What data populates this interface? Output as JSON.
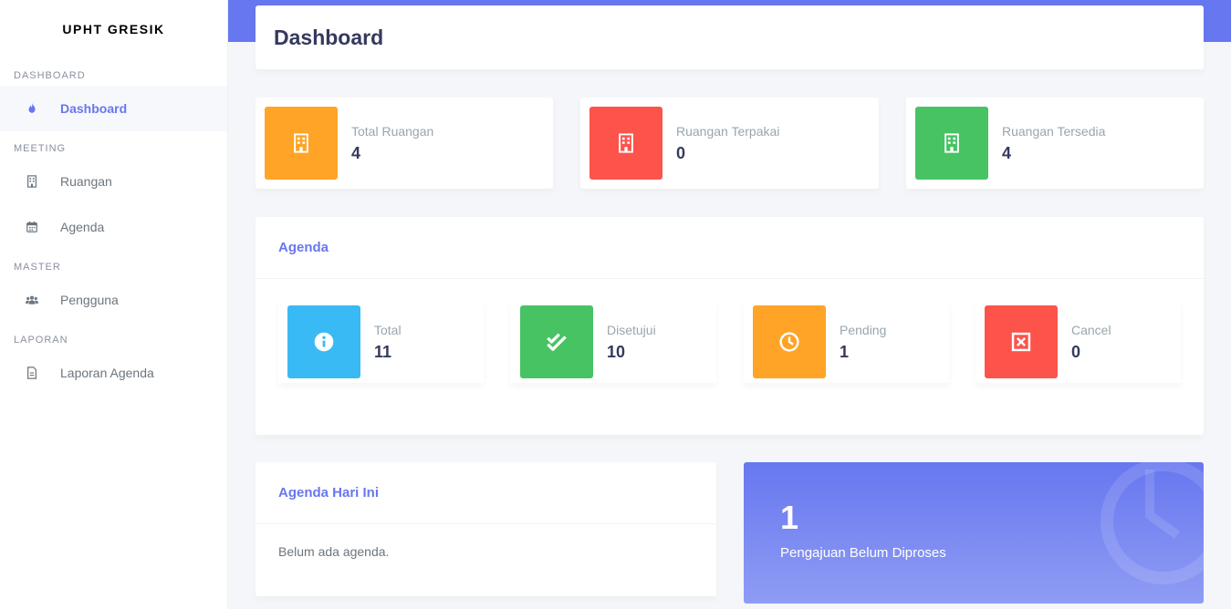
{
  "brand": "UPHT GRESIK",
  "sidebar": {
    "sections": [
      {
        "header": "DASHBOARD",
        "items": [
          {
            "label": "Dashboard",
            "icon": "fire-icon",
            "active": true
          }
        ]
      },
      {
        "header": "MEETING",
        "items": [
          {
            "label": "Ruangan",
            "icon": "building-icon"
          },
          {
            "label": "Agenda",
            "icon": "calendar-icon"
          }
        ]
      },
      {
        "header": "MASTER",
        "items": [
          {
            "label": "Pengguna",
            "icon": "users-icon"
          }
        ]
      },
      {
        "header": "LAPORAN",
        "items": [
          {
            "label": "Laporan Agenda",
            "icon": "file-icon"
          }
        ]
      }
    ]
  },
  "page": {
    "title": "Dashboard"
  },
  "stats": [
    {
      "label": "Total Ruangan",
      "value": "4",
      "color": "#ffa426",
      "icon": "building-icon"
    },
    {
      "label": "Ruangan Terpakai",
      "value": "0",
      "color": "#fc544b",
      "icon": "building-icon"
    },
    {
      "label": "Ruangan Tersedia",
      "value": "4",
      "color": "#47c363",
      "icon": "building-icon"
    }
  ],
  "agenda": {
    "title": "Agenda",
    "items": [
      {
        "label": "Total",
        "value": "11",
        "color": "#3abaf4",
        "icon": "info-icon"
      },
      {
        "label": "Disetujui",
        "value": "10",
        "color": "#47c363",
        "icon": "check-double-icon"
      },
      {
        "label": "Pending",
        "value": "1",
        "color": "#ffa426",
        "icon": "clock-icon"
      },
      {
        "label": "Cancel",
        "value": "0",
        "color": "#fc544b",
        "icon": "x-box-icon"
      }
    ]
  },
  "today": {
    "title": "Agenda Hari Ini",
    "empty_text": "Belum ada agenda."
  },
  "pending_card": {
    "value": "1",
    "label": "Pengajuan Belum Diproses",
    "icon": "clock-icon"
  },
  "colors": {
    "primary": "#6777ef",
    "warning": "#ffa426",
    "danger": "#fc544b",
    "success": "#47c363",
    "info": "#3abaf4"
  }
}
